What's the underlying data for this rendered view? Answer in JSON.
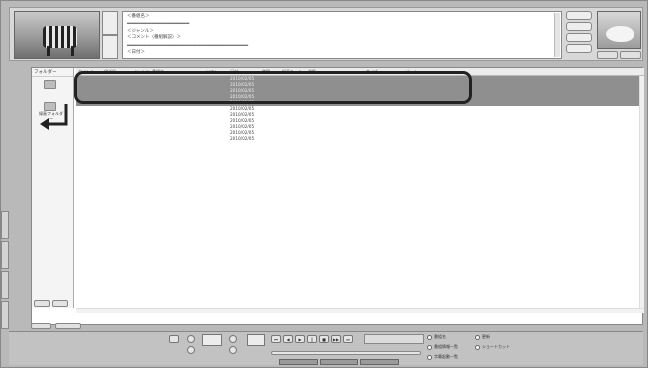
{
  "memo": {
    "lines": [
      "＜番組名＞",
      "＜ジャンル＞",
      "＜コメント（番組解説）＞",
      "＜放送局＞",
      "＜日付＞"
    ]
  },
  "folder_pane": {
    "header": "フォルダー",
    "folders": [
      {
        "label": ""
      },
      {
        "label": "録画フォルダー"
      }
    ]
  },
  "list": {
    "columns": [
      "タイトル",
      "放送局",
      "ジャンル",
      "番組名",
      "ソフト",
      "日付",
      "時間",
      "録画モード",
      "状態",
      "サイズ",
      "ビット"
    ],
    "rows": [
      {
        "title": "",
        "station": "",
        "date": "2010/02/05",
        "mode": "",
        "status": "",
        "size": ""
      },
      {
        "title": "",
        "station": "",
        "date": "2010/02/05",
        "mode": "",
        "status": "",
        "size": ""
      },
      {
        "title": "",
        "station": "",
        "date": "2010/02/05",
        "mode": "",
        "status": "",
        "size": ""
      },
      {
        "title": "",
        "station": "",
        "date": "2010/02/05",
        "mode": "",
        "status": "",
        "size": ""
      },
      {
        "title": "",
        "station": "",
        "date": "2010/02/05",
        "mode": "",
        "status": "",
        "size": ""
      },
      {
        "title": "",
        "station": "",
        "date": "2010/02/05",
        "mode": "",
        "status": "",
        "size": ""
      },
      {
        "title": "",
        "station": "",
        "date": "2010/02/05",
        "mode": "",
        "status": "",
        "size": ""
      },
      {
        "title": "",
        "station": "",
        "date": "2010/02/05",
        "mode": "",
        "status": "",
        "size": ""
      },
      {
        "title": "",
        "station": "",
        "date": "2010/02/05",
        "mode": "",
        "status": "",
        "size": ""
      },
      {
        "title": "",
        "station": "",
        "date": "2010/02/05",
        "mode": "",
        "status": "",
        "size": ""
      },
      {
        "title": "",
        "station": "",
        "date": "2010/02/05",
        "mode": "",
        "status": "",
        "size": ""
      }
    ]
  },
  "controls": {
    "legend": [
      {
        "label": "番組名"
      },
      {
        "label": "番組情報一覧"
      },
      {
        "label": "字幕起動一覧"
      },
      {
        "label": "更新"
      },
      {
        "label": "ショートカット"
      }
    ]
  },
  "colors": {
    "highlight_row": "#8f8f8f",
    "callout": "#222222",
    "panel": "#b9b9b9"
  }
}
